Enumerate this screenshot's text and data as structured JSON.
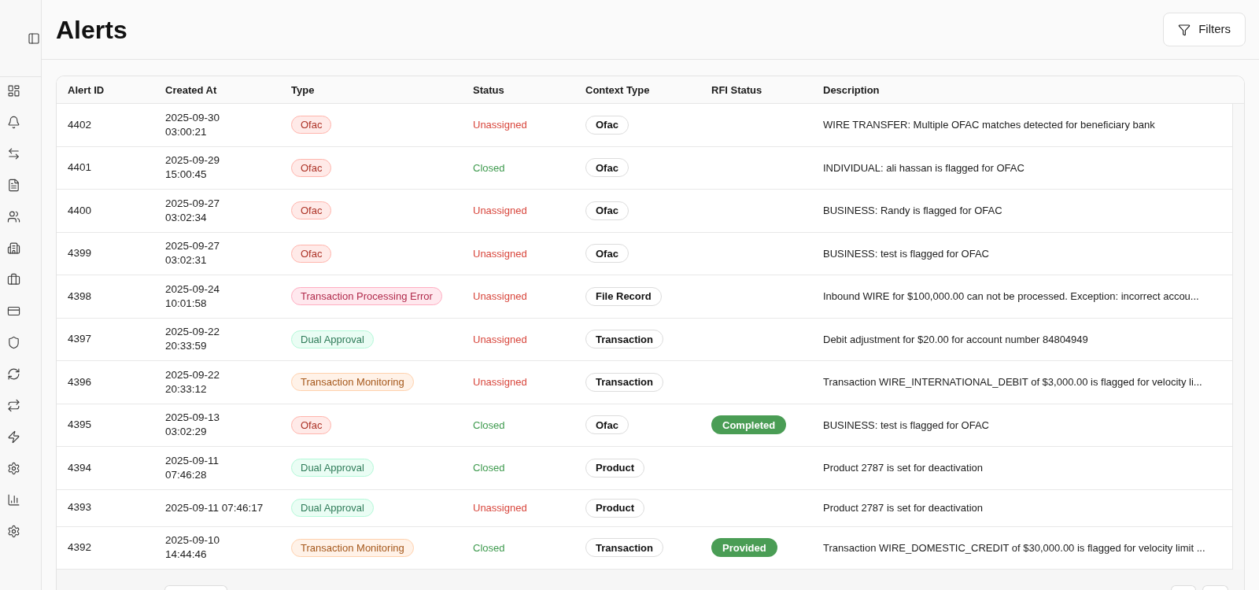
{
  "page": {
    "title": "Alerts"
  },
  "toolbar": {
    "filters_button": "Filters"
  },
  "table": {
    "columns": [
      "Alert ID",
      "Created At",
      "Type",
      "Status",
      "Context Type",
      "RFI Status",
      "Description"
    ],
    "rows": [
      {
        "alert_id": "4402",
        "created_at": "2025-09-30\n03:00:21",
        "type": {
          "label": "Ofac",
          "color": "#ad3327"
        },
        "status": {
          "label": "Unassigned",
          "color": "#d8463c"
        },
        "context_type": "Ofac",
        "description": "WIRE TRANSFER: Multiple OFAC matches detected for beneficiary bank"
      },
      {
        "alert_id": "4401",
        "created_at": "2025-09-29\n15:00:45",
        "type": {
          "label": "Ofac",
          "color": "#ad3327"
        },
        "status": {
          "label": "Closed",
          "color": "#3e9a4e"
        },
        "context_type": "Ofac",
        "description": "INDIVIDUAL: ali hassan is flagged for OFAC"
      },
      {
        "alert_id": "4400",
        "created_at": "2025-09-27\n03:02:34",
        "type": {
          "label": "Ofac",
          "color": "#ad3327"
        },
        "status": {
          "label": "Unassigned",
          "color": "#d8463c"
        },
        "context_type": "Ofac",
        "description": "BUSINESS: Randy is flagged for OFAC"
      },
      {
        "alert_id": "4399",
        "created_at": "2025-09-27\n03:02:31",
        "type": {
          "label": "Ofac",
          "color": "#ad3327"
        },
        "status": {
          "label": "Unassigned",
          "color": "#d8463c"
        },
        "context_type": "Ofac",
        "description": "BUSINESS: test is flagged for OFAC"
      },
      {
        "alert_id": "4398",
        "created_at": "2025-09-24\n10:01:58",
        "type": {
          "label": "Transaction Processing Error",
          "color": "#b12b4c"
        },
        "status": {
          "label": "Unassigned",
          "color": "#d8463c"
        },
        "context_type": "File Record",
        "description": "Inbound WIRE for $100,000.00 can not be processed. Exception: incorrect accou..."
      },
      {
        "alert_id": "4397",
        "created_at": "2025-09-22\n20:33:59",
        "type": {
          "label": "Dual Approval",
          "color": "#2e7b58"
        },
        "status": {
          "label": "Unassigned",
          "color": "#d8463c"
        },
        "context_type": "Transaction",
        "description": "Debit adjustment for $20.00 for account number 84804949"
      },
      {
        "alert_id": "4396",
        "created_at": "2025-09-22\n20:33:12",
        "type": {
          "label": "Transaction Monitoring",
          "color": "#a5581b"
        },
        "status": {
          "label": "Unassigned",
          "color": "#d8463c"
        },
        "context_type": "Transaction",
        "description": "Transaction WIRE_INTERNATIONAL_DEBIT of $3,000.00 is flagged for velocity li..."
      },
      {
        "alert_id": "4395",
        "created_at": "2025-09-13\n03:02:29",
        "type": {
          "label": "Ofac",
          "color": "#ad3327"
        },
        "status": {
          "label": "Closed",
          "color": "#3e9a4e"
        },
        "context_type": "Ofac",
        "rfi_status": "Completed",
        "description": "BUSINESS: test is flagged for OFAC"
      },
      {
        "alert_id": "4394",
        "created_at": "2025-09-11\n07:46:28",
        "type": {
          "label": "Dual Approval",
          "color": "#2e7b58"
        },
        "status": {
          "label": "Closed",
          "color": "#3e9a4e"
        },
        "context_type": "Product",
        "description": "Product 2787 is set for deactivation"
      },
      {
        "alert_id": "4393",
        "created_at": "2025-09-11 07:46:17",
        "type": {
          "label": "Dual Approval",
          "color": "#2e7b58"
        },
        "status": {
          "label": "Unassigned",
          "color": "#d8463c"
        },
        "context_type": "Product",
        "description": "Product 2787 is set for deactivation"
      },
      {
        "alert_id": "4392",
        "created_at": "2025-09-10\n14:44:46",
        "type": {
          "label": "Transaction Monitoring",
          "color": "#a5581b"
        },
        "status": {
          "label": "Closed",
          "color": "#3e9a4e"
        },
        "context_type": "Transaction",
        "rfi_status": "Provided",
        "description": "Transaction WIRE_DOMESTIC_CREDIT of $30,000.00 is flagged for velocity limit ..."
      }
    ]
  }
}
